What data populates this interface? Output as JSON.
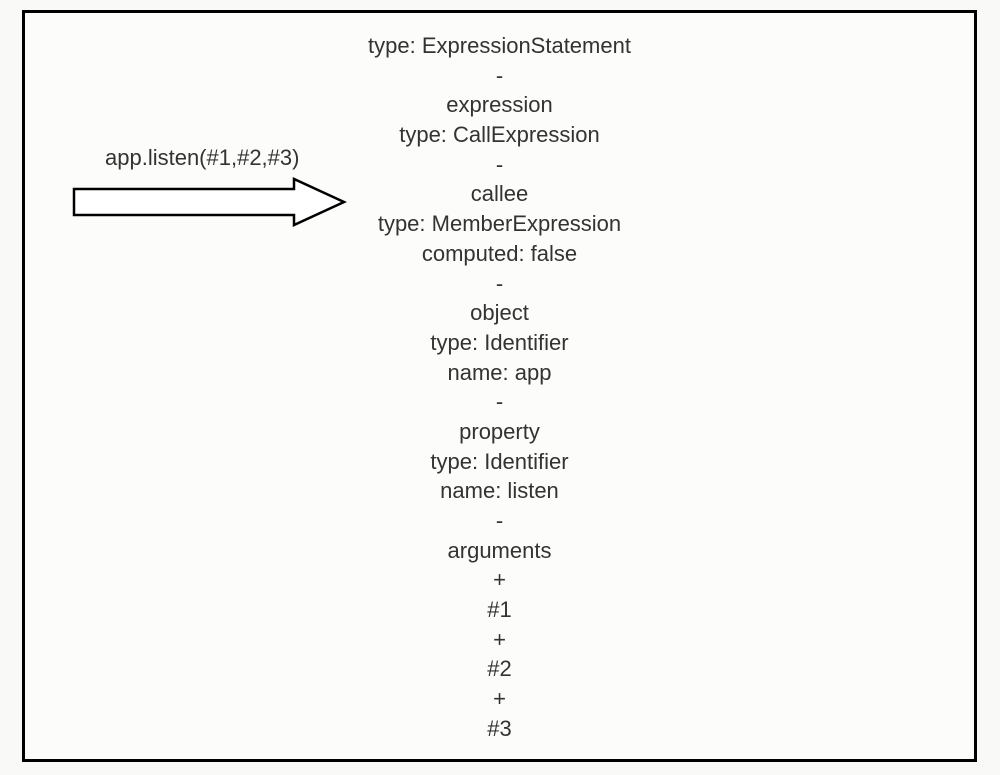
{
  "label": "app.listen(#1,#2,#3)",
  "ast_lines": [
    "type: ExpressionStatement",
    "-",
    "expression",
    "type: CallExpression",
    "-",
    "callee",
    "type: MemberExpression",
    "computed: false",
    "-",
    "object",
    "type: Identifier",
    "name: app",
    "-",
    "property",
    "type: Identifier",
    "name: listen",
    "-",
    "arguments",
    "+",
    "#1",
    "+",
    "#2",
    "+",
    "#3"
  ]
}
